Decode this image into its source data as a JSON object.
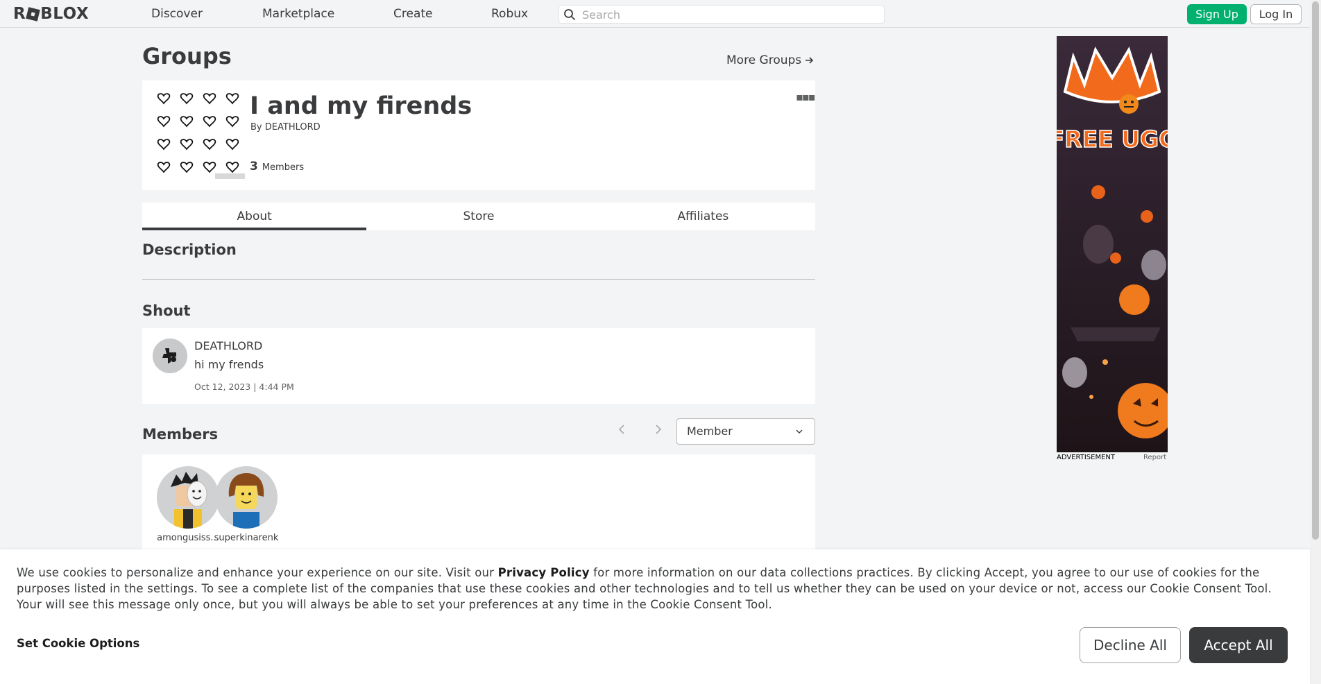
{
  "nav": {
    "logo": "ROBLOX",
    "links": [
      "Discover",
      "Marketplace",
      "Create",
      "Robux"
    ],
    "search_placeholder": "Search",
    "signup_label": "Sign Up",
    "login_label": "Log In"
  },
  "page": {
    "title": "Groups",
    "more_groups_label": "More Groups"
  },
  "group": {
    "name": "I and my firends",
    "by_prefix": "By",
    "owner": "DEATHLORD",
    "member_count": "3",
    "member_label": "Members",
    "menu_icon": "more-horizontal-icon"
  },
  "tabs": [
    "About",
    "Store",
    "Affiliates"
  ],
  "sections": {
    "description": "Description",
    "shout": "Shout",
    "members": "Members"
  },
  "shout": {
    "user": "DEATHLORD",
    "text": "hi my frends",
    "date": "Oct 12, 2023 | 4:44 PM"
  },
  "members_panel": {
    "role_selected": "Member",
    "prev_icon": "chevron-left-icon",
    "next_icon": "chevron-right-icon",
    "list": [
      {
        "name": "amongusiss..."
      },
      {
        "name": "superkinarenk"
      }
    ]
  },
  "ad": {
    "headline": "FREE UGC",
    "label": "ADVERTISEMENT",
    "report": "Report"
  },
  "cookie": {
    "text_before": "We use cookies to personalize and enhance your experience on our site. Visit our ",
    "privacy_link": "Privacy Policy",
    "text_after": " for more information on our data collections practices. By clicking Accept, you agree to our use of cookies for the purposes listed in the settings. To see a complete list of the companies that use these cookies and other technologies and to tell us whether they can be used on your device or not, access our Cookie Consent Tool. Your will see this message only once, but you will always be able to set your preferences at any time in the Cookie Consent Tool.",
    "set_options": "Set Cookie Options",
    "decline": "Decline All",
    "accept": "Accept All"
  },
  "colors": {
    "accent_green": "#00b06f",
    "text": "#393b3d",
    "background": "#f2f4f5"
  }
}
